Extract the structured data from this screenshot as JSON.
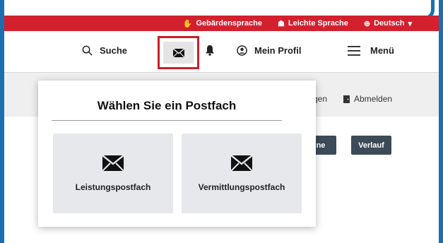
{
  "topbar": {
    "sign_language": "Gebärdensprache",
    "easy_language": "Leichte Sprache",
    "language": "Deutsch",
    "color": "#d3202f"
  },
  "header": {
    "search_label": "Suche",
    "profile_label": "Mein Profil",
    "menu_label": "Menü"
  },
  "band": {
    "partial_left": "gen",
    "logout_label": "Abmelden"
  },
  "buttons": {
    "partial_button": "ne",
    "history_button": "Verlauf"
  },
  "mailbox_dropdown": {
    "title": "Wählen Sie ein Postfach",
    "options": [
      {
        "label": "Leistungspostfach",
        "icon": "envelope-icon"
      },
      {
        "label": "Vermittlungspostfach",
        "icon": "envelope-icon"
      }
    ]
  },
  "accent_colors": {
    "highlight_frame": "#1b6fb0",
    "highlight_box": "#c8202c"
  }
}
